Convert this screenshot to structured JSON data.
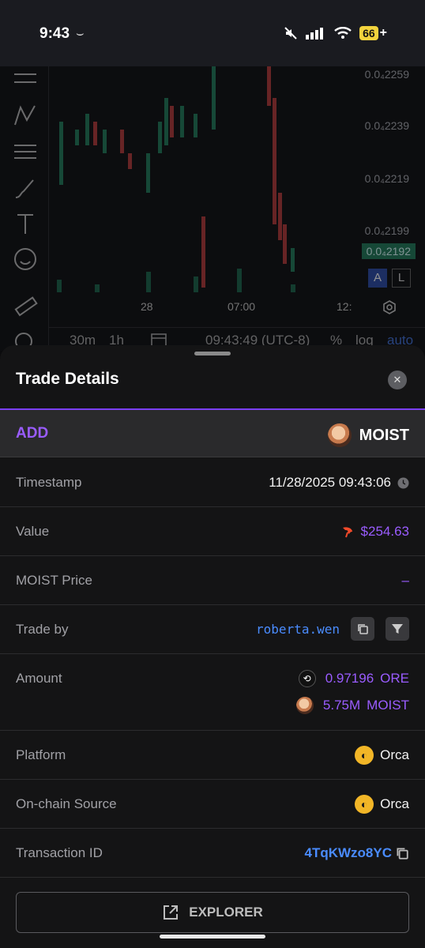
{
  "status": {
    "time": "9:43",
    "battery": "66"
  },
  "chart": {
    "price_labels": [
      "0.0₄2259",
      "0.0₄2239",
      "0.0₄2219",
      "0.0₄2199"
    ],
    "current_price": "0.0₄2192",
    "x_labels": [
      "28",
      "07:00",
      "12:"
    ],
    "scale_a": "A",
    "scale_l": "L",
    "interval_30m": "30m",
    "interval_1h": "1h",
    "clock": "09:43:49 (UTC-8)",
    "percent": "%",
    "log": "log",
    "auto": "auto"
  },
  "sheet": {
    "title": "Trade Details",
    "type": "ADD",
    "token": "MOIST",
    "rows": {
      "timestamp": {
        "label": "Timestamp",
        "value": "11/28/2025 09:43:06"
      },
      "value": {
        "label": "Value",
        "value": "$254.63"
      },
      "price": {
        "label": "MOIST Price",
        "value": "–"
      },
      "trader": {
        "label": "Trade by",
        "value": "roberta.wen"
      },
      "amount": {
        "label": "Amount",
        "ore_amount": "0.97196",
        "ore_symbol": "ORE",
        "moist_amount": "5.75M",
        "moist_symbol": "MOIST"
      },
      "platform": {
        "label": "Platform",
        "value": "Orca"
      },
      "source": {
        "label": "On-chain Source",
        "value": "Orca"
      },
      "txid": {
        "label": "Transaction ID",
        "value": "4TqKWzo8YC"
      }
    },
    "explorer_label": "EXPLORER"
  },
  "colors": {
    "accent": "#9a5cff",
    "link": "#4a8cff",
    "bull": "#1f7a5a",
    "bear": "#b33a3a"
  }
}
